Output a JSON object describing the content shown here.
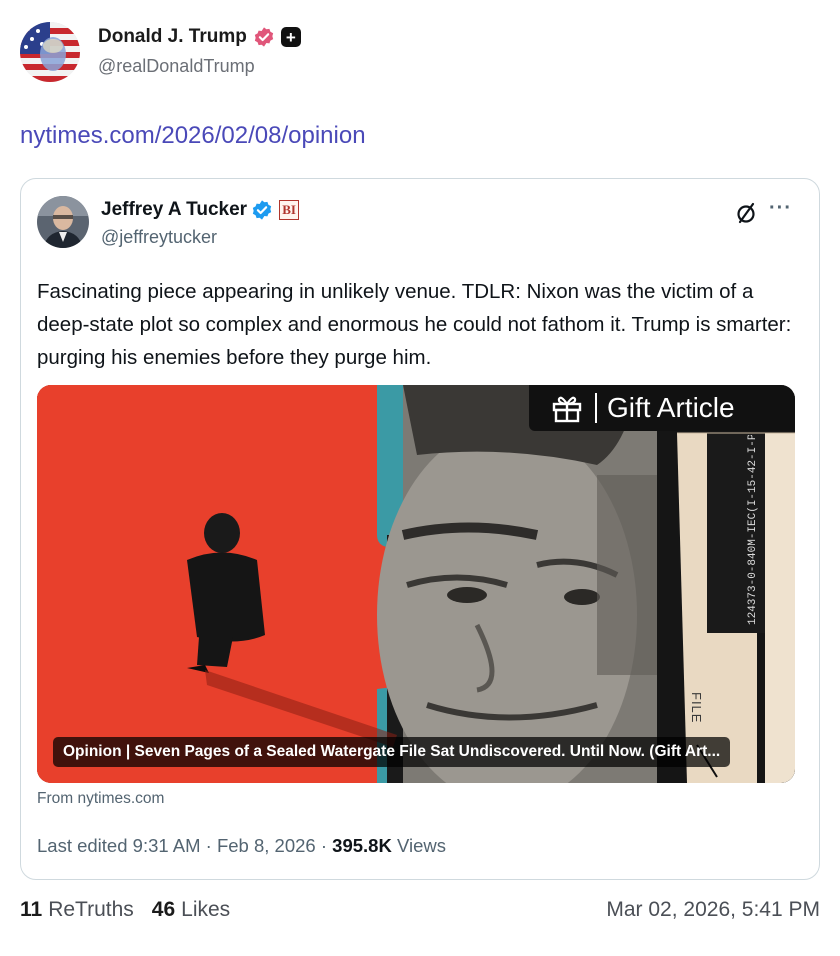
{
  "post": {
    "author_name": "Donald J. Trump",
    "author_handle": "@realDonaldTrump",
    "link_text": "nytimes.com/2026/02/08/opinion",
    "badges": [
      "verified-pink-icon",
      "plus-badge-icon"
    ],
    "colors": {
      "link": "#4a49b8",
      "verified": "#e0567a"
    }
  },
  "embed": {
    "author_name": "Jeffrey A Tucker",
    "author_handle": "@jeffreytucker",
    "affiliate_badge": "BI",
    "text": "Fascinating piece appearing in unlikely venue. TDLR: Nixon was the victim of a deep-state plot so complex and enormous he could not fathom it. Trump is smarter: purging his enemies before they purge him.",
    "article": {
      "gift_label": "Gift Article",
      "caption": "Opinion | Seven Pages of a Sealed Watergate File Sat Undiscovered. Until Now. (Gift Art...",
      "file_tab_code": "124373-0-840M-IEC(I-15-42-I-P",
      "file_label": "FILE"
    },
    "source": "From nytimes.com",
    "edited_prefix": "Last edited 9:31 AM · Feb 8, 2026 · ",
    "views_count": "395.8K",
    "views_label": "Views",
    "colors": {
      "verified": "#1d9bf0",
      "art_red": "#e8402c",
      "art_teal": "#3b9aa5"
    }
  },
  "footer": {
    "retruths_count": "11",
    "retruths_label": "ReTruths",
    "likes_count": "46",
    "likes_label": "Likes",
    "date": "Mar 02, 2026, 5:41 PM"
  }
}
